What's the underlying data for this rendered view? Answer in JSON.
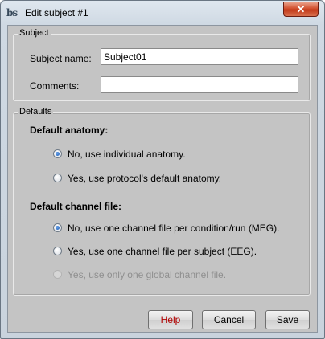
{
  "window": {
    "app_icon": "brainstorm-logo-icon",
    "title": "Edit subject #1",
    "close_glyph": "✕"
  },
  "subject_group": {
    "legend": "Subject",
    "name_label": "Subject name:",
    "name_value": "Subject01",
    "comments_label": "Comments:",
    "comments_value": ""
  },
  "defaults_group": {
    "legend": "Defaults",
    "anatomy": {
      "title": "Default anatomy:",
      "options": [
        {
          "label": "No, use individual anatomy.",
          "checked": true,
          "enabled": true
        },
        {
          "label": "Yes, use protocol's default anatomy.",
          "checked": false,
          "enabled": true
        }
      ]
    },
    "channel": {
      "title": "Default channel file:",
      "options": [
        {
          "label": "No, use one channel file per condition/run (MEG).",
          "checked": true,
          "enabled": true
        },
        {
          "label": "Yes, use one channel file per subject (EEG).",
          "checked": false,
          "enabled": true
        },
        {
          "label": "Yes, use only one global channel file.",
          "checked": false,
          "enabled": false
        }
      ]
    }
  },
  "buttons": {
    "help": "Help",
    "cancel": "Cancel",
    "save": "Save"
  },
  "colors": {
    "help_text": "#b00000",
    "radio_selected": "#1a5bb8",
    "panel_background": "#c4c4c4"
  }
}
